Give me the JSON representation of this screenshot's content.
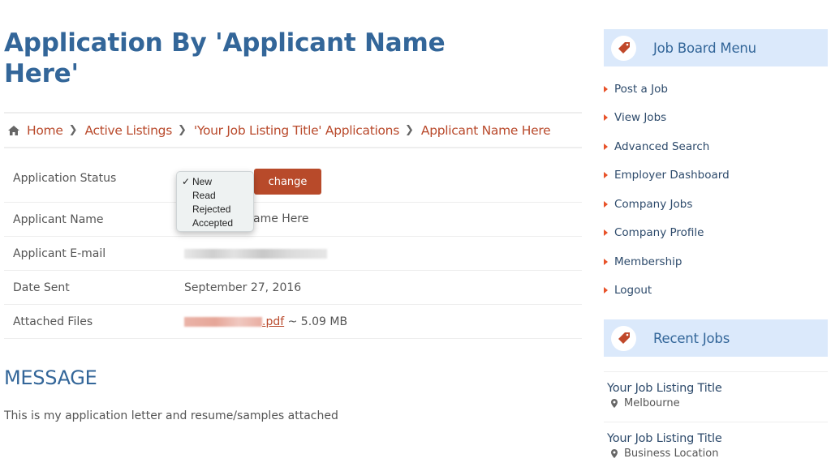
{
  "page": {
    "title": "Application By 'Applicant Name Here'"
  },
  "breadcrumb": {
    "items": [
      {
        "label": "Home",
        "icon": "home-icon"
      },
      {
        "label": "Active Listings"
      },
      {
        "label": "'Your Job Listing Title' Applications"
      },
      {
        "label": "Applicant Name Here"
      }
    ],
    "separator": "❯"
  },
  "details": {
    "status_label": "Application Status",
    "status_options": [
      "New",
      "Read",
      "Rejected",
      "Accepted"
    ],
    "status_selected": "New",
    "status_check": "✓",
    "change_button": "change",
    "name_label": "Applicant Name",
    "name_value": "Applicant Name Here",
    "name_value_visible": "ame Here",
    "email_label": "Applicant E-mail",
    "date_label": "Date Sent",
    "date_value": "September 27, 2016",
    "files_label": "Attached Files",
    "file_ext": ".pdf",
    "file_size": " ~ 5.09 MB"
  },
  "message": {
    "heading": "MESSAGE",
    "text": "This is my application letter and resume/samples attached"
  },
  "sidebar": {
    "menu_title": "Job Board Menu",
    "menu_items": [
      "Post a Job",
      "View Jobs",
      "Advanced Search",
      "Employer Dashboard",
      "Company Jobs",
      "Company Profile",
      "Membership",
      "Logout"
    ],
    "recent_title": "Recent Jobs",
    "recent_jobs": [
      {
        "title": "Your Job Listing Title",
        "location": "Melbourne"
      },
      {
        "title": "Your Job Listing Title",
        "location": "Business Location"
      }
    ]
  },
  "colors": {
    "heading_blue": "#336699",
    "accent_orange": "#b84a2a",
    "widget_bg": "#dbe9fb",
    "bullet_orange": "#e8532a"
  }
}
